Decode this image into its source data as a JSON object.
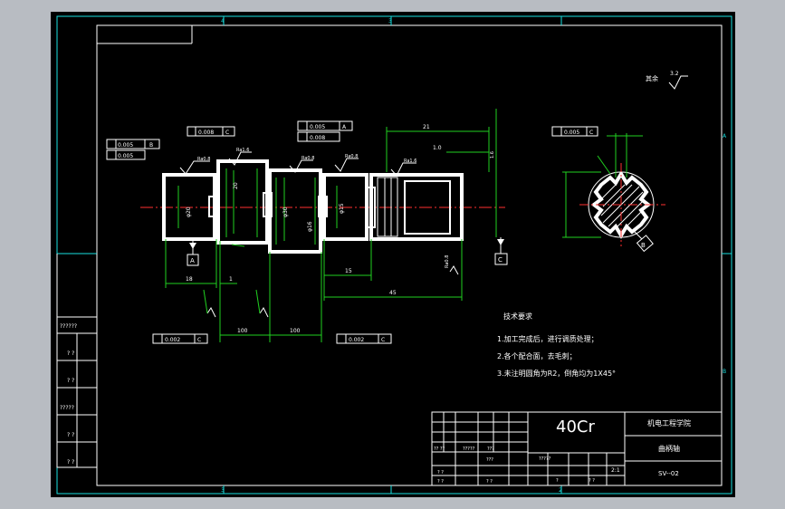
{
  "drawing": {
    "material": "40Cr",
    "school": "机电工程学院",
    "part_name": "曲柄轴",
    "drawing_no": "SV--02",
    "scale": "2:1",
    "roughness_note": "其余",
    "roughness_value": "3.2",
    "tech_req_title": "技术要求",
    "tech_req": [
      "1.加工完成后，进行调质处理；",
      "2.各个配合面，去毛刺；",
      "3.未注明圆角为R2，倒角均为1X45°"
    ],
    "datums": {
      "a": "A",
      "c": "C",
      "b": "B"
    },
    "tolerances": {
      "t1": "0.005",
      "t2": "0.005",
      "t3": "0.008",
      "t4": "0.005",
      "t5": "0.008",
      "t6": "0.008",
      "t7": "0.002",
      "t8": "0.002",
      "t9": "0.005"
    },
    "gtol_datums": {
      "b": "B",
      "c": "C",
      "a": "A"
    },
    "dims": {
      "d1": "1.6",
      "d2": "18",
      "d3": "1",
      "d4": "15",
      "d5": "45",
      "d6": "21",
      "d7": "1.0",
      "d8": "100",
      "d9": "100",
      "d10": "φ20",
      "d11": "20",
      "d12": "φ30",
      "d13": "φ15",
      "d14": "φ16"
    },
    "roughness_marks": {
      "r1": "Ra0.8",
      "r2": "Ra1.6",
      "r3": "Ra0.8",
      "r4": "Ra0.8",
      "r5": "Ra1.6",
      "r6": "Ra0.8"
    },
    "left_table": [
      "??????",
      "? ?",
      "? ?",
      "?????",
      "? ?",
      "? ?"
    ],
    "title_block": {
      "r1": [
        "?? ??",
        "?????",
        "???",
        "?????"
      ],
      "r2": [
        "? ?",
        "???"
      ],
      "r3": [
        "? ?",
        "? ?",
        "?",
        "? ?"
      ]
    },
    "frame_letters": {
      "top": "4",
      "top2": "3",
      "right_a": "A",
      "right_b": "B",
      "bottom": "3",
      "bottom2": "2"
    }
  }
}
